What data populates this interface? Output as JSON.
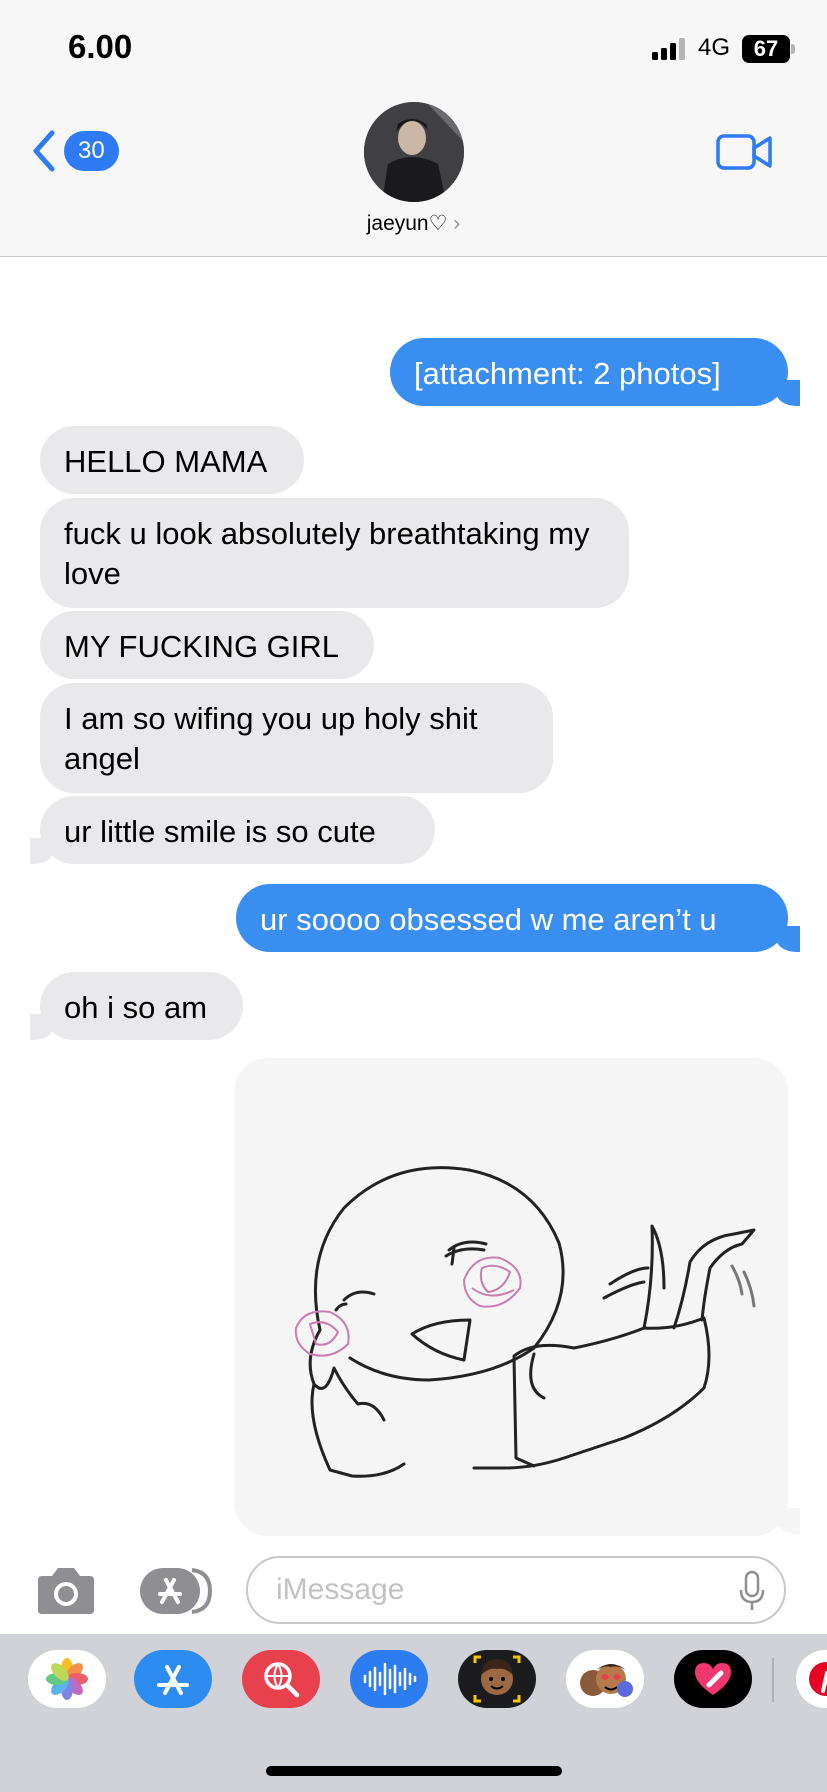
{
  "status_bar": {
    "time": "6.00",
    "network": "4G",
    "battery": "67"
  },
  "header": {
    "back_count": "30",
    "contact_name": "jaeyun♡",
    "chevron": "›"
  },
  "messages": [
    {
      "direction": "outgoing",
      "text": "[attachment: 2 photos]"
    },
    {
      "direction": "incoming",
      "text": "HELLO MAMA"
    },
    {
      "direction": "incoming",
      "text": "fuck u look absolutely breathtaking my love"
    },
    {
      "direction": "incoming",
      "text": "MY FUCKING GIRL"
    },
    {
      "direction": "incoming",
      "text": "I am so wifing you up holy shit angel"
    },
    {
      "direction": "incoming",
      "text": "ur little smile is so cute"
    },
    {
      "direction": "outgoing",
      "text": "ur soooo obsessed w me aren’t u"
    },
    {
      "direction": "incoming",
      "text": "oh i so am"
    },
    {
      "direction": "outgoing",
      "type": "image",
      "description": "sketch-sticker"
    }
  ],
  "compose": {
    "placeholder": "iMessage"
  },
  "app_drawer": [
    "photos-app-icon",
    "app-store-app-icon",
    "image-search-app-icon",
    "audio-app-icon",
    "memoji-app-icon",
    "animoji-app-icon",
    "digital-touch-app-icon",
    "pinterest-app-icon"
  ],
  "colors": {
    "outgoing_bubble": "#3a8ef0",
    "incoming_bubble": "#e9e9eb",
    "accent": "#2f7bf4"
  }
}
